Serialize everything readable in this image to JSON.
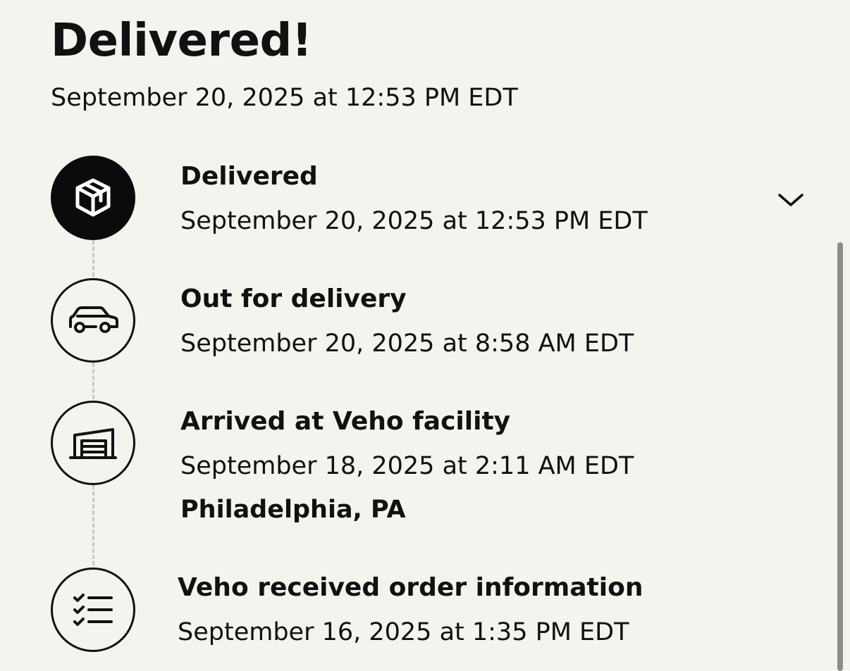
{
  "header": {
    "title": "Delivered!",
    "timestamp": "September 20, 2025 at 12:53 PM EDT"
  },
  "timeline": {
    "steps": [
      {
        "title": "Delivered",
        "date": "September 20, 2025 at 12:53 PM EDT",
        "icon": "package-icon",
        "active": true
      },
      {
        "title": "Out for delivery",
        "date": "September 20, 2025 at 8:58 AM EDT",
        "icon": "car-icon",
        "active": false
      },
      {
        "title": "Arrived at Veho facility",
        "date": "September 18, 2025 at 2:11 AM EDT",
        "location": "Philadelphia, PA",
        "icon": "warehouse-icon",
        "active": false
      },
      {
        "title": "Veho received order information",
        "date": "September 16, 2025 at 1:35 PM EDT",
        "icon": "checklist-icon",
        "active": false
      }
    ],
    "expand_icon": "chevron-down-icon"
  },
  "colors": {
    "background": "#f4f3ee",
    "text": "#111111",
    "active_icon_bg": "#0b0b0b",
    "connector": "#c9c8c2",
    "scrollbar": "#8d8d8a"
  }
}
